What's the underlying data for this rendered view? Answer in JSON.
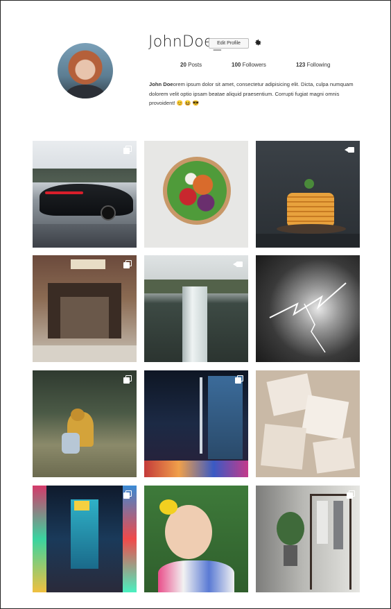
{
  "profile": {
    "username": "JohnDoe_",
    "edit_label": "Edit Profile",
    "settings_icon": "gear-icon",
    "avatar_icon": "profile-photo"
  },
  "stats": {
    "posts": {
      "count": "20",
      "label": "Posts"
    },
    "followers": {
      "count": "100",
      "label": "Followers"
    },
    "following": {
      "count": "123",
      "label": "Following"
    }
  },
  "bio": {
    "name": "John Doe",
    "text": "orem ipsum dolor sit amet, consectetur adipisicing elit. Dicta, culpa numquam dolorem velit optio ipsam beatae aliquid praesentium. Corrupti fugiat magni omnis provoident! 😊 😆 😎"
  },
  "gallery": {
    "items": [
      {
        "subject": "car",
        "badge": "multi"
      },
      {
        "subject": "food-bowl",
        "badge": "none"
      },
      {
        "subject": "pancakes",
        "badge": "video"
      },
      {
        "subject": "storefront",
        "badge": "multi"
      },
      {
        "subject": "waterfall",
        "badge": "video"
      },
      {
        "subject": "lightning",
        "badge": "none"
      },
      {
        "subject": "child-in-raincoat",
        "badge": "multi"
      },
      {
        "subject": "city-night",
        "badge": "multi"
      },
      {
        "subject": "photo-prints",
        "badge": "none"
      },
      {
        "subject": "neon-street",
        "badge": "multi"
      },
      {
        "subject": "child-with-paint",
        "badge": "none"
      },
      {
        "subject": "clothing-rack",
        "badge": "multi"
      }
    ]
  }
}
